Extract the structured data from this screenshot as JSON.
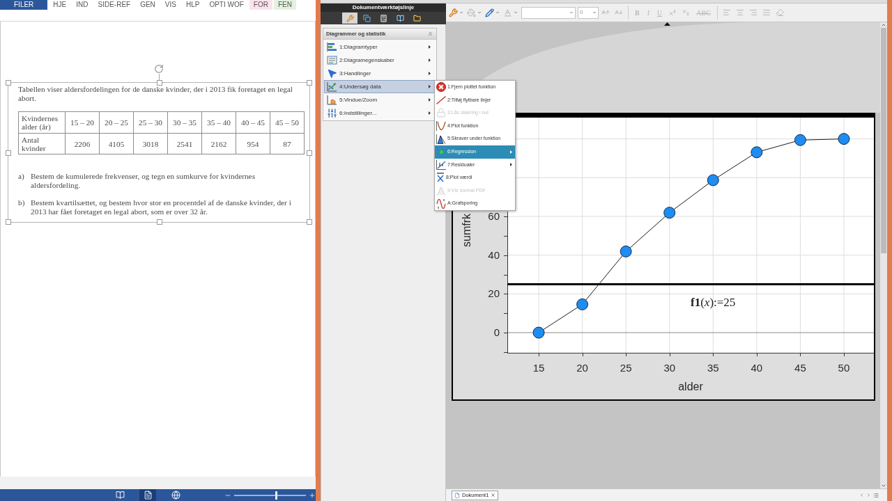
{
  "word": {
    "ribbon_tabs": [
      {
        "label": "FILER",
        "color": "#2b579a"
      },
      {
        "label": "HJE",
        "color": "#ffffff"
      },
      {
        "label": "IND",
        "color": "#ffffff"
      },
      {
        "label": "SIDE-REF",
        "color": "#ffffff"
      },
      {
        "label": "GEN",
        "color": "#ffffff"
      },
      {
        "label": "VIS",
        "color": "#ffffff"
      },
      {
        "label": "HLP",
        "color": "#ffffff"
      },
      {
        "label": "OPTI WOF",
        "color": "#ffffff"
      },
      {
        "label": "FOR",
        "color": "#fbe3ee"
      },
      {
        "label": "FEN",
        "color": "#e3f1df"
      }
    ],
    "document": {
      "intro": "Tabellen viser aldersfordelingen for de danske kvinder, der i 2013 fik foretaget en legal abort.",
      "table": {
        "rows": [
          [
            "Kvindernes alder (år)",
            "15 – 20",
            "20 – 25",
            "25 – 30",
            "30 – 35",
            "35 – 40",
            "40 – 45",
            "45 – 50"
          ],
          [
            "Antal kvinder",
            "2206",
            "4105",
            "3018",
            "2541",
            "2162",
            "954",
            "87"
          ]
        ]
      },
      "questions": [
        {
          "label": "a)",
          "text": "Bestem de kumulerede frekvenser, og tegn en sumkurve for kvindernes aldersfordeling."
        },
        {
          "label": "b)",
          "text": "Bestem kvartilsættet, og bestem hvor stor en procentdel af de danske kvinder, der i 2013 har fået foretaget en legal abort, som er over 32 år."
        }
      ]
    },
    "status_bar": {
      "views": [
        {
          "selected": false
        },
        {
          "selected": true
        },
        {
          "selected": false
        }
      ],
      "zoom": {
        "level": 0.6
      }
    }
  },
  "nspire": {
    "toolbar_title": "Dokumentværktøjslinje",
    "toolbar_tabs": [
      {
        "selected": true
      },
      {
        "selected": false
      },
      {
        "selected": false
      },
      {
        "selected": false
      },
      {
        "selected": false
      }
    ],
    "menu": {
      "title": "Diagrammer og statistik",
      "items": [
        {
          "label": "1:Diagramtyper",
          "selected": false,
          "submenu": true
        },
        {
          "label": "2:Diagramegenskaber",
          "selected": false,
          "submenu": true
        },
        {
          "label": "3:Handlinger",
          "selected": false,
          "submenu": true
        },
        {
          "label": "4:Undersøg data",
          "selected": true,
          "submenu": true
        },
        {
          "label": "5:Vindue/Zoom",
          "selected": false,
          "submenu": true
        },
        {
          "label": "6:Indstillinger...",
          "selected": false,
          "submenu": true
        }
      ]
    },
    "submenu": [
      {
        "label": "1:Fjern plottet funktion",
        "selected": false,
        "disabled": false,
        "submenu": false
      },
      {
        "label": "2:Tilføj flytbare linjer",
        "selected": false,
        "disabled": false,
        "submenu": false
      },
      {
        "label": "3:Lås skæring i nul",
        "selected": false,
        "disabled": true,
        "submenu": false
      },
      {
        "label": "4:Plot funktion",
        "selected": false,
        "disabled": false,
        "submenu": false
      },
      {
        "label": "5:Skraver under funktion",
        "selected": false,
        "disabled": false,
        "submenu": false
      },
      {
        "label": "6:Regression",
        "selected": true,
        "disabled": false,
        "submenu": true
      },
      {
        "label": "7:Residualer",
        "selected": false,
        "disabled": false,
        "submenu": true
      },
      {
        "label": "8:Plot værdi",
        "selected": false,
        "disabled": false,
        "submenu": false
      },
      {
        "label": "9:Vis normal PDF",
        "selected": false,
        "disabled": true,
        "submenu": false
      },
      {
        "label": "A:Grafsporing",
        "selected": false,
        "disabled": false,
        "submenu": false
      }
    ],
    "format_toolbar": {
      "font_size": "0",
      "text_buttons": [
        {
          "label": "B",
          "kind": "bold",
          "disabled": true
        },
        {
          "label": "I",
          "kind": "italic",
          "disabled": true
        },
        {
          "label": "U",
          "kind": "underline",
          "disabled": true
        },
        {
          "label": "ABC",
          "kind": "strike",
          "disabled": true
        }
      ]
    },
    "graph": {
      "chart_data": {
        "type": "line",
        "xlabel": "alder",
        "ylabel": "sumfrk",
        "x": [
          15,
          20,
          25,
          30,
          35,
          40,
          45,
          50
        ],
        "series": [
          {
            "color": "#1e8cf0",
            "marker": "o",
            "values": [
              0,
              14.6,
              41.9,
              61.9,
              78.7,
              93.1,
              99.4,
              100
            ]
          }
        ],
        "xlim": [
          11.4,
          53.44
        ],
        "ylim": [
          -10.4,
          111
        ],
        "xticks": [
          15,
          20,
          25,
          30,
          35,
          40,
          45,
          50
        ],
        "yticks": [
          0,
          20,
          40,
          60
        ],
        "grid": true,
        "ref_lines": [
          {
            "axis": "y",
            "value": 25,
            "label": "**f1**(*x*):=25"
          }
        ]
      }
    },
    "doc_tabs": [
      {
        "label": "Dokument1",
        "selected": true
      }
    ]
  }
}
